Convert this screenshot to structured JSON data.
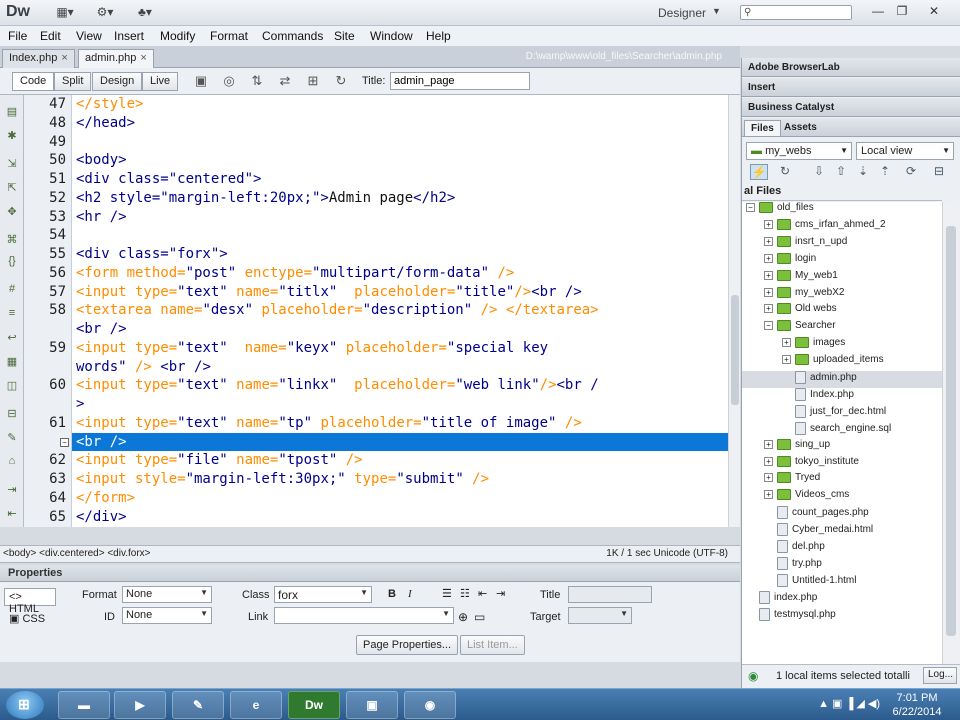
{
  "app": {
    "logo": "Dw",
    "workspace": "Designer",
    "icons": [
      "layout-icon",
      "gear-icon",
      "extensions-icon"
    ]
  },
  "menu": [
    "File",
    "Edit",
    "View",
    "Insert",
    "Modify",
    "Format",
    "Commands",
    "Site",
    "Window",
    "Help"
  ],
  "doc_tabs": [
    {
      "label": "Index.php",
      "active": false
    },
    {
      "label": "admin.php",
      "active": true
    }
  ],
  "doc_path": "D:\\wamp\\www\\old_files\\Searcher\\admin.php",
  "toolbar": {
    "views": [
      "Code",
      "Split",
      "Design",
      "Live"
    ],
    "title_label": "Title:",
    "title_value": "admin_page"
  },
  "code": {
    "lines": [
      {
        "num": "47",
        "segments": [
          {
            "t": "</style>",
            "c": "form"
          }
        ]
      },
      {
        "num": "48",
        "segments": [
          {
            "t": "</head>",
            "c": "tag"
          }
        ]
      },
      {
        "num": "49",
        "segments": []
      },
      {
        "num": "50",
        "segments": [
          {
            "t": "<body>",
            "c": "tag"
          }
        ]
      },
      {
        "num": "51",
        "segments": [
          {
            "t": "<div class=\"centered\">",
            "c": "tag"
          }
        ]
      },
      {
        "num": "52",
        "segments": [
          {
            "t": "<h2 style=\"margin-left:20px;\">",
            "c": "tag"
          },
          {
            "t": "Admin page",
            "c": "text"
          },
          {
            "t": "</h2>",
            "c": "tag"
          }
        ]
      },
      {
        "num": "53",
        "segments": [
          {
            "t": "<hr />",
            "c": "tag"
          }
        ]
      },
      {
        "num": "54",
        "segments": []
      },
      {
        "num": "55",
        "segments": [
          {
            "t": "<div class=\"forx\">",
            "c": "tag"
          }
        ]
      },
      {
        "num": "56",
        "segments": [
          {
            "t": "<form method=",
            "c": "form"
          },
          {
            "t": "\"post\"",
            "c": "str"
          },
          {
            "t": " enctype=",
            "c": "form"
          },
          {
            "t": "\"multipart/form-data\"",
            "c": "str"
          },
          {
            "t": " />",
            "c": "form"
          }
        ]
      },
      {
        "num": "57",
        "segments": [
          {
            "t": "<input type=",
            "c": "form"
          },
          {
            "t": "\"text\"",
            "c": "str"
          },
          {
            "t": " name=",
            "c": "form"
          },
          {
            "t": "\"titlx\"",
            "c": "str"
          },
          {
            "t": "  placeholder=",
            "c": "form"
          },
          {
            "t": "\"title\"",
            "c": "str"
          },
          {
            "t": "/>",
            "c": "form"
          },
          {
            "t": "<br />",
            "c": "tag"
          }
        ]
      },
      {
        "num": "58",
        "segments": [
          {
            "t": "<textarea name=",
            "c": "form"
          },
          {
            "t": "\"desx\"",
            "c": "str"
          },
          {
            "t": " placeholder=",
            "c": "form"
          },
          {
            "t": "\"description\"",
            "c": "str"
          },
          {
            "t": " /> </textarea>",
            "c": "form"
          }
        ]
      },
      {
        "num": "",
        "segments": [
          {
            "t": "<br />",
            "c": "tag"
          }
        ]
      },
      {
        "num": "59",
        "segments": [
          {
            "t": "<input type=",
            "c": "form"
          },
          {
            "t": "\"text\"",
            "c": "str"
          },
          {
            "t": "  name=",
            "c": "form"
          },
          {
            "t": "\"keyx\"",
            "c": "str"
          },
          {
            "t": " placeholder=",
            "c": "form"
          },
          {
            "t": "\"special key",
            "c": "str"
          }
        ]
      },
      {
        "num": "",
        "segments": [
          {
            "t": "words\"",
            "c": "str"
          },
          {
            "t": " />",
            "c": "form"
          },
          {
            "t": " <br />",
            "c": "tag"
          }
        ]
      },
      {
        "num": "60",
        "segments": [
          {
            "t": "<input type=",
            "c": "form"
          },
          {
            "t": "\"text\"",
            "c": "str"
          },
          {
            "t": " name=",
            "c": "form"
          },
          {
            "t": "\"linkx\"",
            "c": "str"
          },
          {
            "t": "  placeholder=",
            "c": "form"
          },
          {
            "t": "\"web link\"",
            "c": "str"
          },
          {
            "t": "/>",
            "c": "form"
          },
          {
            "t": "<br /",
            "c": "tag"
          }
        ]
      },
      {
        "num": "",
        "segments": [
          {
            "t": ">",
            "c": "tag"
          }
        ]
      },
      {
        "num": "61",
        "segments": [
          {
            "t": "<input type=",
            "c": "form"
          },
          {
            "t": "\"text\"",
            "c": "str"
          },
          {
            "t": " name=",
            "c": "form"
          },
          {
            "t": "\"tp\"",
            "c": "str"
          },
          {
            "t": " placeholder=",
            "c": "form"
          },
          {
            "t": "\"title of image\"",
            "c": "str"
          },
          {
            "t": " />",
            "c": "form"
          }
        ]
      },
      {
        "num": "",
        "selected": true,
        "segments": [
          {
            "t": "<br />",
            "c": "sel"
          }
        ]
      },
      {
        "num": "62",
        "segments": [
          {
            "t": "<input type=",
            "c": "form"
          },
          {
            "t": "\"file\"",
            "c": "str"
          },
          {
            "t": " name=",
            "c": "form"
          },
          {
            "t": "\"tpost\"",
            "c": "str"
          },
          {
            "t": " />",
            "c": "form"
          }
        ]
      },
      {
        "num": "63",
        "segments": [
          {
            "t": "<input style=",
            "c": "form"
          },
          {
            "t": "\"margin-left:30px;\"",
            "c": "str"
          },
          {
            "t": " type=",
            "c": "form"
          },
          {
            "t": "\"submit\"",
            "c": "str"
          },
          {
            "t": " />",
            "c": "form"
          }
        ]
      },
      {
        "num": "64",
        "segments": [
          {
            "t": "</form>",
            "c": "form"
          }
        ]
      },
      {
        "num": "65",
        "segments": [
          {
            "t": "</div>",
            "c": "tag"
          }
        ]
      }
    ]
  },
  "status": {
    "tag_selector": "<body> <div.centered> <div.forx>",
    "info": "1K / 1 sec  Unicode (UTF-8)"
  },
  "properties": {
    "title": "Properties",
    "html_label": "HTML",
    "css_label": "CSS",
    "format_label": "Format",
    "format_value": "None",
    "class_label": "Class",
    "class_value": "forx",
    "id_label": "ID",
    "id_value": "None",
    "link_label": "Link",
    "title_label": "Title",
    "target_label": "Target",
    "bold": "B",
    "italic": "I",
    "page_properties_btn": "Page Properties...",
    "list_item_btn": "List Item..."
  },
  "right": {
    "browserlab": "Adobe BrowserLab",
    "insert": "Insert",
    "business_catalyst": "Business Catalyst",
    "tabs": [
      "Files",
      "Assets"
    ],
    "site_select": "my_webs",
    "view_select": "Local view",
    "local_files_hdr": "al Files",
    "tree": [
      {
        "label": "old_files",
        "depth": 0,
        "type": "folder",
        "exp": "−"
      },
      {
        "label": "cms_irfan_ahmed_2",
        "depth": 1,
        "type": "folder",
        "exp": "+"
      },
      {
        "label": "insrt_n_upd",
        "depth": 1,
        "type": "folder",
        "exp": "+"
      },
      {
        "label": "login",
        "depth": 1,
        "type": "folder",
        "exp": "+"
      },
      {
        "label": "My_web1",
        "depth": 1,
        "type": "folder",
        "exp": "+"
      },
      {
        "label": "my_webX2",
        "depth": 1,
        "type": "folder",
        "exp": "+"
      },
      {
        "label": "Old webs",
        "depth": 1,
        "type": "folder",
        "exp": "+"
      },
      {
        "label": "Searcher",
        "depth": 1,
        "type": "folder",
        "exp": "−"
      },
      {
        "label": "images",
        "depth": 2,
        "type": "folder",
        "exp": "+"
      },
      {
        "label": "uploaded_items",
        "depth": 2,
        "type": "folder",
        "exp": "+"
      },
      {
        "label": "admin.php",
        "depth": 2,
        "type": "file",
        "selected": true
      },
      {
        "label": "Index.php",
        "depth": 2,
        "type": "file"
      },
      {
        "label": "just_for_dec.html",
        "depth": 2,
        "type": "file"
      },
      {
        "label": "search_engine.sql",
        "depth": 2,
        "type": "file"
      },
      {
        "label": "sing_up",
        "depth": 1,
        "type": "folder",
        "exp": "+"
      },
      {
        "label": "tokyo_institute",
        "depth": 1,
        "type": "folder",
        "exp": "+"
      },
      {
        "label": "Tryed",
        "depth": 1,
        "type": "folder",
        "exp": "+"
      },
      {
        "label": "Videos_cms",
        "depth": 1,
        "type": "folder",
        "exp": "+"
      },
      {
        "label": "count_pages.php",
        "depth": 1,
        "type": "file"
      },
      {
        "label": "Cyber_medai.html",
        "depth": 1,
        "type": "file"
      },
      {
        "label": "del.php",
        "depth": 1,
        "type": "file"
      },
      {
        "label": "try.php",
        "depth": 1,
        "type": "file"
      },
      {
        "label": "Untitled-1.html",
        "depth": 1,
        "type": "file"
      },
      {
        "label": "index.php",
        "depth": 0,
        "type": "file"
      },
      {
        "label": "testmysql.php",
        "depth": 0,
        "type": "file"
      }
    ],
    "files_status": "1 local items selected totalli",
    "log_btn": "Log..."
  },
  "taskbar": {
    "clock_time": "7:01 PM",
    "clock_date": "6/22/2014",
    "items": [
      "explorer",
      "media",
      "notepad",
      "ie",
      "Dw",
      "network",
      "firefox"
    ]
  },
  "colors": {
    "tag": "#00008b",
    "form": "#ff8c00",
    "selection": "#0b77d6"
  }
}
